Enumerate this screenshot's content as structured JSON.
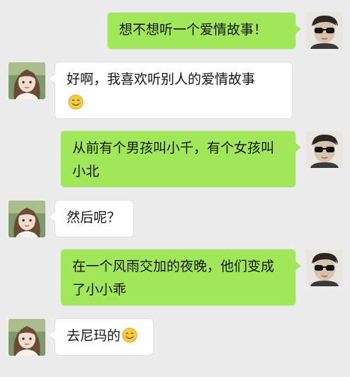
{
  "messages": [
    {
      "sender": "me",
      "text": "想不想听一个爱情故事！"
    },
    {
      "sender": "her",
      "text": "好啊，我喜欢听别人的爱情故事",
      "emoji": "smile-emoji"
    },
    {
      "sender": "me",
      "text": "从前有个男孩叫小千，有个女孩叫小北"
    },
    {
      "sender": "her",
      "text": "然后呢？"
    },
    {
      "sender": "me",
      "text": "在一个风雨交加的夜晚，他们变成了小小乖"
    },
    {
      "sender": "her",
      "text": "去尼玛的",
      "emoji": "smile-emoji"
    }
  ],
  "colors": {
    "background": "#ececec",
    "my_bubble": "#a0e75a",
    "her_bubble": "#ffffff"
  },
  "icons": {
    "my_avatar": "man-with-sunglasses-avatar",
    "her_avatar": "girl-avatar",
    "emoji": "smile-emoji"
  }
}
